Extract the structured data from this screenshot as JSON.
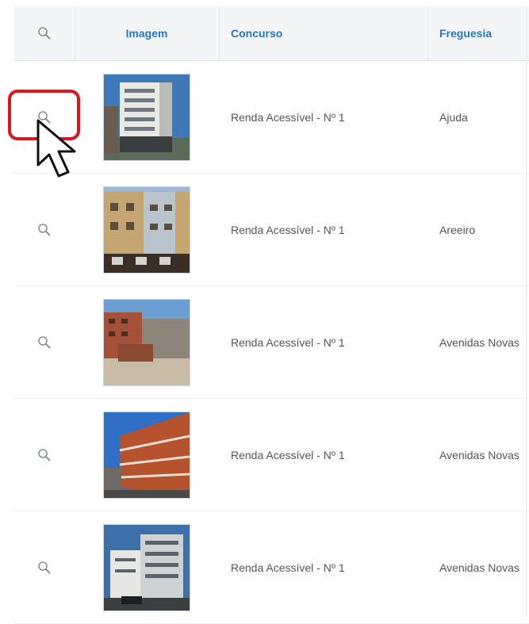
{
  "table": {
    "columns": {
      "view": "",
      "image": "Imagem",
      "contest": "Concurso",
      "parish": "Freguesia"
    },
    "rows": [
      {
        "contest": "Renda Acessível - Nº 1",
        "parish": "Ajuda",
        "photo": "building-photo-1"
      },
      {
        "contest": "Renda Acessível - Nº 1",
        "parish": "Areeiro",
        "photo": "building-photo-2"
      },
      {
        "contest": "Renda Acessível - Nº 1",
        "parish": "Avenidas Novas",
        "photo": "building-photo-3"
      },
      {
        "contest": "Renda Acessível - Nº 1",
        "parish": "Avenidas Novas",
        "photo": "building-photo-4"
      },
      {
        "contest": "Renda Acessível - Nº 1",
        "parish": "Avenidas Novas",
        "photo": "building-photo-5"
      }
    ]
  },
  "icons": {
    "view": "magnifier-icon",
    "pointer": "mouse-cursor-icon"
  },
  "colors": {
    "header_text": "#2a74c6",
    "highlight": "#e0141e",
    "header_bg": "#f3f5f7"
  }
}
